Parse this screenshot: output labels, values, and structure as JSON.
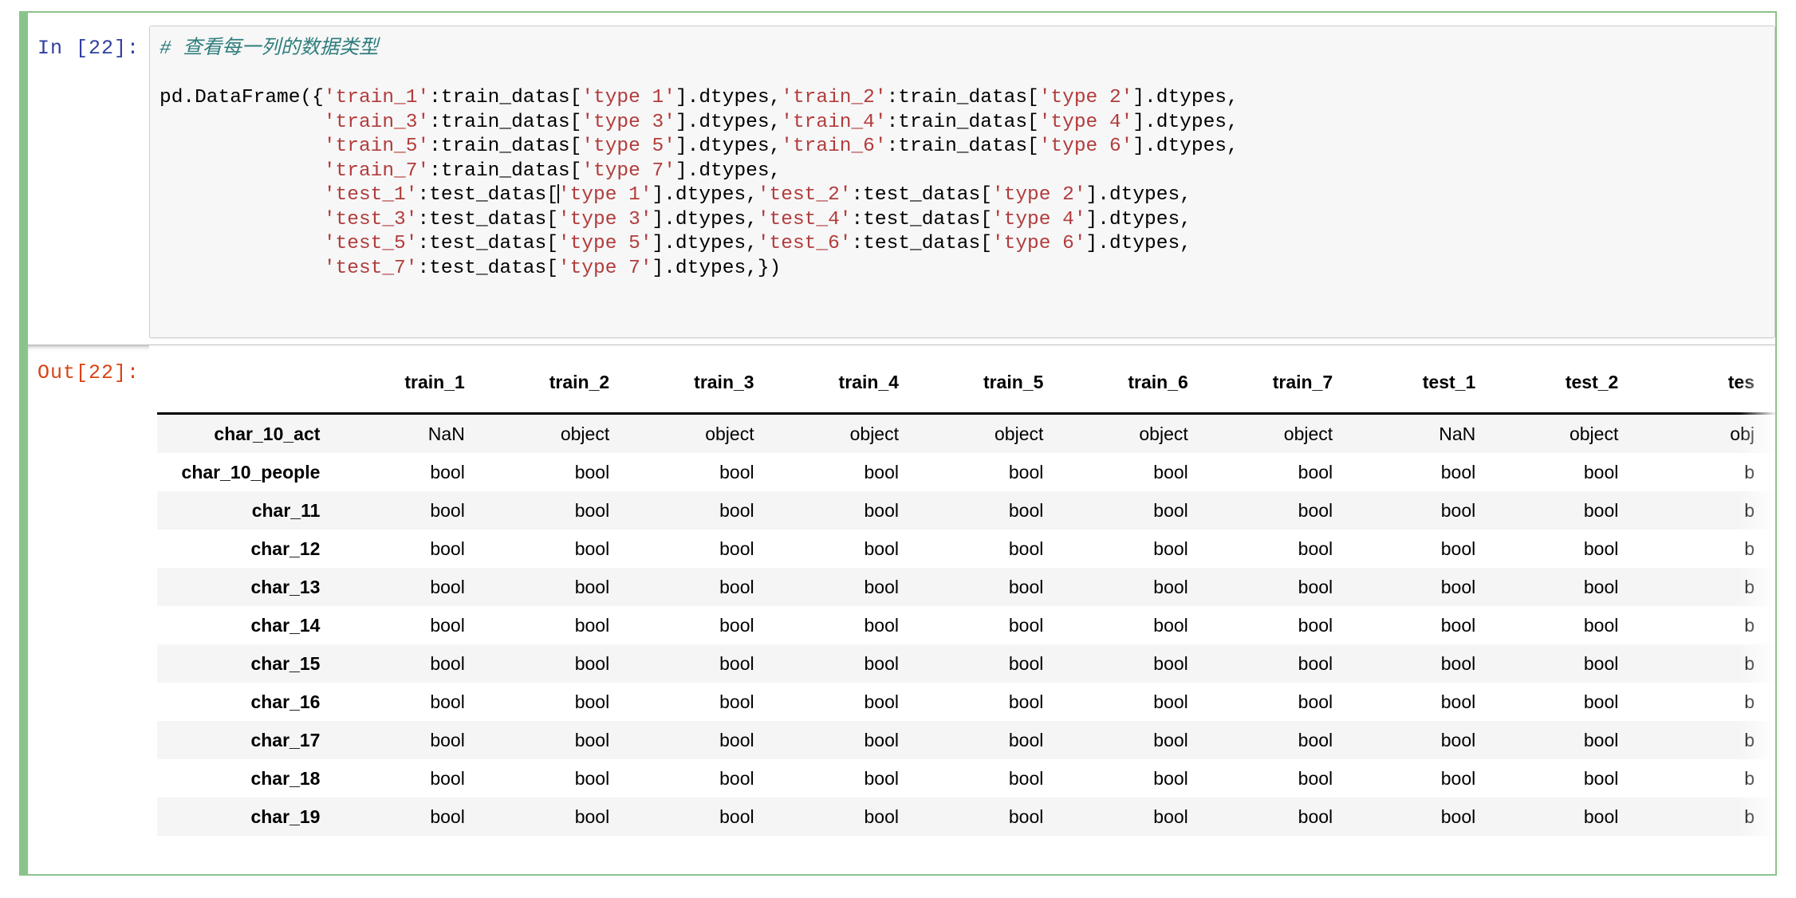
{
  "cell": {
    "input_prompt": "In [22]:",
    "output_prompt": "Out[22]:",
    "prompt_color": "#303f9f",
    "output_prompt_color": "#d84315",
    "selected_border_color": "#8bc48b"
  },
  "code": {
    "comment": "# 查看每一列的数据类型",
    "lines": [
      {
        "segments": [
          {
            "t": "plain",
            "v": "pd.DataFrame({"
          },
          {
            "t": "str",
            "v": "'train_1'"
          },
          {
            "t": "plain",
            "v": ":train_datas["
          },
          {
            "t": "str",
            "v": "'type 1'"
          },
          {
            "t": "plain",
            "v": "].dtypes,"
          },
          {
            "t": "str",
            "v": "'train_2'"
          },
          {
            "t": "plain",
            "v": ":train_datas["
          },
          {
            "t": "str",
            "v": "'type 2'"
          },
          {
            "t": "plain",
            "v": "].dtypes,"
          }
        ]
      },
      {
        "segments": [
          {
            "t": "plain",
            "v": "              "
          },
          {
            "t": "str",
            "v": "'train_3'"
          },
          {
            "t": "plain",
            "v": ":train_datas["
          },
          {
            "t": "str",
            "v": "'type 3'"
          },
          {
            "t": "plain",
            "v": "].dtypes,"
          },
          {
            "t": "str",
            "v": "'train_4'"
          },
          {
            "t": "plain",
            "v": ":train_datas["
          },
          {
            "t": "str",
            "v": "'type 4'"
          },
          {
            "t": "plain",
            "v": "].dtypes,"
          }
        ]
      },
      {
        "segments": [
          {
            "t": "plain",
            "v": "              "
          },
          {
            "t": "str",
            "v": "'train_5'"
          },
          {
            "t": "plain",
            "v": ":train_datas["
          },
          {
            "t": "str",
            "v": "'type 5'"
          },
          {
            "t": "plain",
            "v": "].dtypes,"
          },
          {
            "t": "str",
            "v": "'train_6'"
          },
          {
            "t": "plain",
            "v": ":train_datas["
          },
          {
            "t": "str",
            "v": "'type 6'"
          },
          {
            "t": "plain",
            "v": "].dtypes,"
          }
        ]
      },
      {
        "segments": [
          {
            "t": "plain",
            "v": "              "
          },
          {
            "t": "str",
            "v": "'train_7'"
          },
          {
            "t": "plain",
            "v": ":train_datas["
          },
          {
            "t": "str",
            "v": "'type 7'"
          },
          {
            "t": "plain",
            "v": "].dtypes,"
          }
        ]
      },
      {
        "caret_after_segment": 2,
        "segments": [
          {
            "t": "plain",
            "v": "              "
          },
          {
            "t": "str",
            "v": "'test_1'"
          },
          {
            "t": "plain",
            "v": ":test_datas["
          },
          {
            "t": "str",
            "v": "'type 1'"
          },
          {
            "t": "plain",
            "v": "].dtypes,"
          },
          {
            "t": "str",
            "v": "'test_2'"
          },
          {
            "t": "plain",
            "v": ":test_datas["
          },
          {
            "t": "str",
            "v": "'type 2'"
          },
          {
            "t": "plain",
            "v": "].dtypes,"
          }
        ]
      },
      {
        "segments": [
          {
            "t": "plain",
            "v": "              "
          },
          {
            "t": "str",
            "v": "'test_3'"
          },
          {
            "t": "plain",
            "v": ":test_datas["
          },
          {
            "t": "str",
            "v": "'type 3'"
          },
          {
            "t": "plain",
            "v": "].dtypes,"
          },
          {
            "t": "str",
            "v": "'test_4'"
          },
          {
            "t": "plain",
            "v": ":test_datas["
          },
          {
            "t": "str",
            "v": "'type 4'"
          },
          {
            "t": "plain",
            "v": "].dtypes,"
          }
        ]
      },
      {
        "segments": [
          {
            "t": "plain",
            "v": "              "
          },
          {
            "t": "str",
            "v": "'test_5'"
          },
          {
            "t": "plain",
            "v": ":test_datas["
          },
          {
            "t": "str",
            "v": "'type 5'"
          },
          {
            "t": "plain",
            "v": "].dtypes,"
          },
          {
            "t": "str",
            "v": "'test_6'"
          },
          {
            "t": "plain",
            "v": ":test_datas["
          },
          {
            "t": "str",
            "v": "'type 6'"
          },
          {
            "t": "plain",
            "v": "].dtypes,"
          }
        ]
      },
      {
        "segments": [
          {
            "t": "plain",
            "v": "              "
          },
          {
            "t": "str",
            "v": "'test_7'"
          },
          {
            "t": "plain",
            "v": ":test_datas["
          },
          {
            "t": "str",
            "v": "'type 7'"
          },
          {
            "t": "plain",
            "v": "].dtypes,})"
          }
        ]
      }
    ]
  },
  "dataframe": {
    "index_header": "",
    "columns": [
      "train_1",
      "train_2",
      "train_3",
      "train_4",
      "train_5",
      "train_6",
      "train_7",
      "test_1",
      "test_2",
      "tes"
    ],
    "index": [
      "char_10_act",
      "char_10_people",
      "char_11",
      "char_12",
      "char_13",
      "char_14",
      "char_15",
      "char_16",
      "char_17",
      "char_18",
      "char_19"
    ],
    "rows": [
      [
        "NaN",
        "object",
        "object",
        "object",
        "object",
        "object",
        "object",
        "NaN",
        "object",
        "obj"
      ],
      [
        "bool",
        "bool",
        "bool",
        "bool",
        "bool",
        "bool",
        "bool",
        "bool",
        "bool",
        "b"
      ],
      [
        "bool",
        "bool",
        "bool",
        "bool",
        "bool",
        "bool",
        "bool",
        "bool",
        "bool",
        "b"
      ],
      [
        "bool",
        "bool",
        "bool",
        "bool",
        "bool",
        "bool",
        "bool",
        "bool",
        "bool",
        "b"
      ],
      [
        "bool",
        "bool",
        "bool",
        "bool",
        "bool",
        "bool",
        "bool",
        "bool",
        "bool",
        "b"
      ],
      [
        "bool",
        "bool",
        "bool",
        "bool",
        "bool",
        "bool",
        "bool",
        "bool",
        "bool",
        "b"
      ],
      [
        "bool",
        "bool",
        "bool",
        "bool",
        "bool",
        "bool",
        "bool",
        "bool",
        "bool",
        "b"
      ],
      [
        "bool",
        "bool",
        "bool",
        "bool",
        "bool",
        "bool",
        "bool",
        "bool",
        "bool",
        "b"
      ],
      [
        "bool",
        "bool",
        "bool",
        "bool",
        "bool",
        "bool",
        "bool",
        "bool",
        "bool",
        "b"
      ],
      [
        "bool",
        "bool",
        "bool",
        "bool",
        "bool",
        "bool",
        "bool",
        "bool",
        "bool",
        "b"
      ],
      [
        "bool",
        "bool",
        "bool",
        "bool",
        "bool",
        "bool",
        "bool",
        "bool",
        "bool",
        "b"
      ]
    ]
  }
}
